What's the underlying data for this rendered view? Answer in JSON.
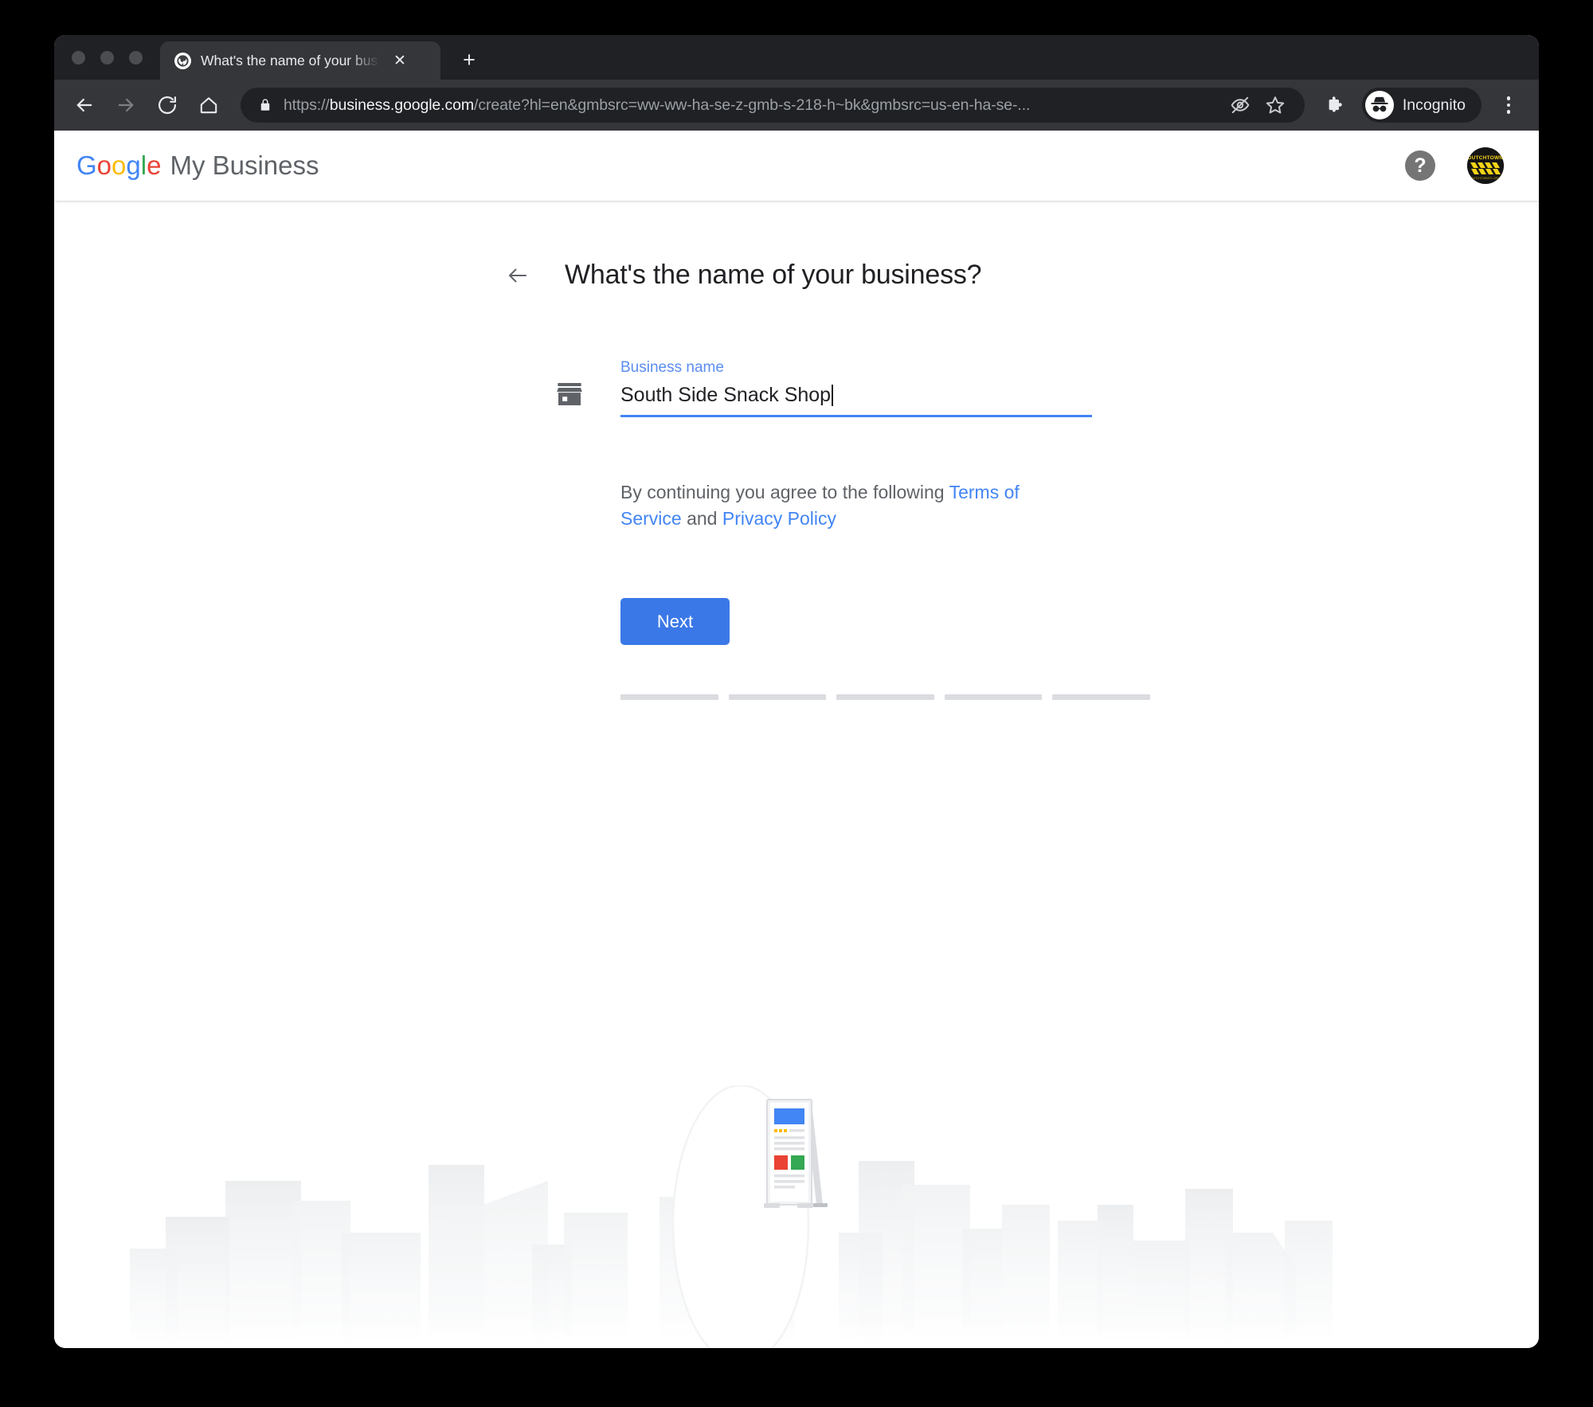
{
  "browser": {
    "traffic_lights": [
      "close",
      "minimize",
      "maximize"
    ],
    "tab": {
      "title": "What's the name of your busin",
      "favicon": "globe-icon",
      "close_label": "✕"
    },
    "new_tab_label": "+",
    "toolbar": {
      "back_label": "←",
      "forward_label": "→",
      "reload_label": "⟳",
      "home_label": "⌂",
      "url_scheme": "https://",
      "url_host": "business.google.com",
      "url_path": "/create?hl=en&gmbsrc=ww-ww-ha-se-z-gmb-s-218-h~bk&gmbsrc=us-en-ha-se-...",
      "full_url": "https://business.google.com/create?hl=en&gmbsrc=ww-ww-ha-se-z-gmb-s-218-h~bk&gmbsrc=us-en-ha-se-...",
      "lock_icon": "lock-icon",
      "tracking_protection_icon": "eye-slash-icon",
      "bookmark_icon": "star-icon",
      "extensions_icon": "puzzle-piece-icon",
      "profile_icon": "incognito-hat-icon",
      "profile_label": "Incognito",
      "menu_icon": "three-dots-icon"
    }
  },
  "app_header": {
    "logo_google": [
      "G",
      "o",
      "o",
      "g",
      "l",
      "e"
    ],
    "logo_suffix": "My Business",
    "help_icon": "question-mark-icon",
    "help_label": "?",
    "avatar_name": "account-avatar",
    "avatar_text": "DUTCHTOWN"
  },
  "main": {
    "back_icon": "arrow-left-icon",
    "title": "What's the name of your business?",
    "store_icon": "storefront-icon",
    "field": {
      "label": "Business name",
      "value": "South Side Snack Shop",
      "placeholder": "Business name"
    },
    "terms": {
      "prefix": "By continuing you agree to the following ",
      "link1": "Terms of Service",
      "middle": " and ",
      "link2": "Privacy Policy"
    },
    "next_label": "Next",
    "progress": {
      "total_steps": 5,
      "completed_steps": 0
    }
  },
  "colors": {
    "accent_blue": "#4285F4",
    "button_blue": "#3b78e7",
    "google_blue": "#4285F4",
    "google_red": "#EA4335",
    "google_yellow": "#FBBC05",
    "google_green": "#34A853",
    "text_primary": "#202124",
    "text_secondary": "#5f6368",
    "chrome_dark": "#202124",
    "chrome_toolbar": "#35363a",
    "progress_gray": "#dadce0"
  }
}
